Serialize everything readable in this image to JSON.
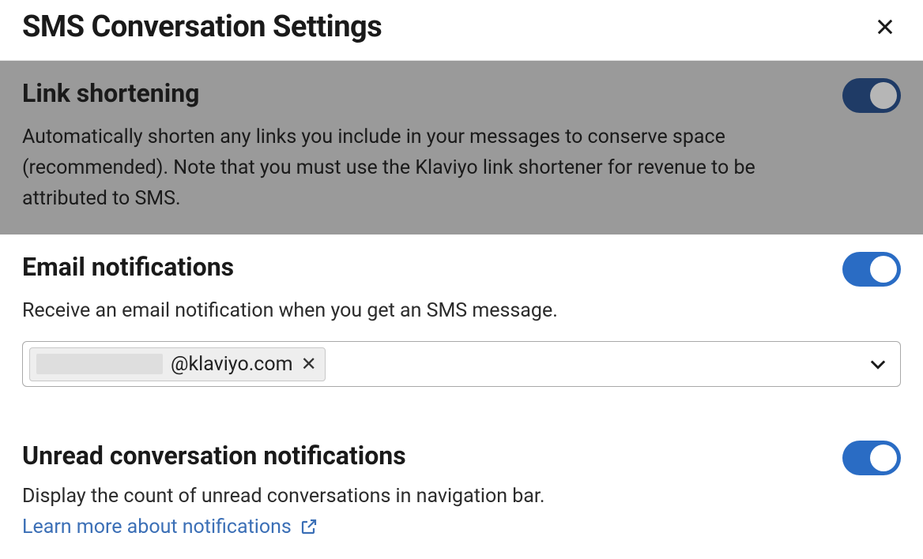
{
  "header": {
    "title": "SMS Conversation Settings"
  },
  "sections": {
    "link_shortening": {
      "title": "Link shortening",
      "description": "Automatically shorten any links you include in your messages to conserve space (recommended). Note that you must use the Klaviyo link shortener for revenue to be attributed to SMS.",
      "toggle_on": true
    },
    "email_notifications": {
      "title": "Email notifications",
      "description": "Receive an email notification when you get an SMS message.",
      "toggle_on": true,
      "chip_domain": "@klaviyo.com"
    },
    "unread_notifications": {
      "title": "Unread conversation notifications",
      "description": "Display the count of unread conversations in navigation bar.",
      "learn_more_label": "Learn more about notifications",
      "toggle_on": true
    }
  }
}
